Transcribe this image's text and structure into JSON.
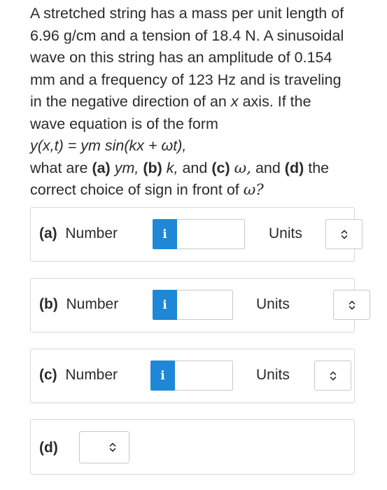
{
  "problem": {
    "line1": "A stretched string has a mass per unit length of",
    "line2": "6.96 g/cm and a tension of 18.4 N. A sinusoidal",
    "line3": "wave on this string has an amplitude of 0.154",
    "line4": "mm and a frequency of 123 Hz and is traveling",
    "line5_pre": "in the negative direction of an ",
    "line5_x": "x",
    "line5_post": " axis. If the",
    "line6": "wave equation is of the form",
    "equation": "y(x,t) = ym sin(kx + ωt),",
    "question_pre": "what are ",
    "a_tag": "(a)",
    "a_sym": "ym,",
    "b_tag": "(b)",
    "b_sym": "k,",
    "and_text": " and ",
    "c_tag": "(c)",
    "c_sym": "ω,",
    "d_tag": "(d)",
    "question_post": " the",
    "last_line_pre": "correct choice of sign in front of ",
    "last_line_sym": "ω?"
  },
  "answers": [
    {
      "part": "(a)",
      "label": "Number",
      "info": "i",
      "units_label": "Units",
      "value": ""
    },
    {
      "part": "(b)",
      "label": "Number",
      "info": "i",
      "units_label": "Units",
      "value": ""
    },
    {
      "part": "(c)",
      "label": "Number",
      "info": "i",
      "units_label": "Units",
      "value": ""
    }
  ],
  "part_d": {
    "part": "(d)"
  },
  "colors": {
    "info_button": "#1e88d6",
    "border": "#d8d8d8"
  },
  "icons": {
    "info": "info-icon",
    "select": "chevron-up-down-icon"
  }
}
